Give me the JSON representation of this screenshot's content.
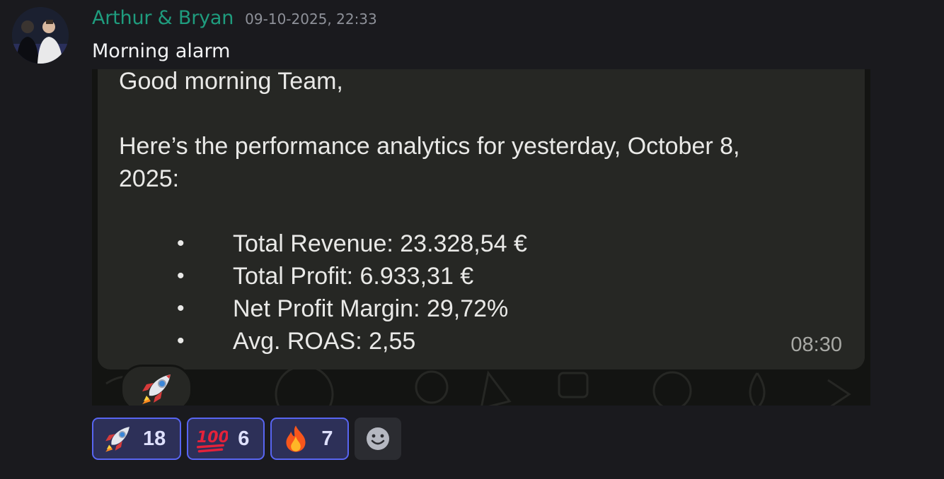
{
  "message": {
    "author": "Arthur & Bryan",
    "timestamp": "09-10-2025, 22:33",
    "text": "Morning alarm"
  },
  "attachment": {
    "greeting": "Good morning Team,",
    "intro_line1": "Here’s the performance analytics for yesterday, October 8,",
    "intro_line2": "2025:",
    "bullet_char": "•",
    "stats": [
      "Total Revenue: 23.328,54 €",
      "Total Profit: 6.933,31 €",
      "Net Profit Margin: 29,72%",
      "Avg. ROAS: 2,55"
    ],
    "sent_time": "08:30",
    "reaction_icon": "rocket-emoji"
  },
  "reactions": [
    {
      "emoji": "rocket-emoji",
      "count": "18"
    },
    {
      "emoji": "hundred-points-emoji",
      "count": "6"
    },
    {
      "emoji": "fire-emoji",
      "count": "7"
    }
  ],
  "add_reaction_icon": "smiley-face-icon",
  "colors": {
    "author": "#1f9c7e",
    "reaction_border": "#5865f2",
    "reaction_bg": "#2d3058",
    "bubble_bg": "#262724"
  }
}
